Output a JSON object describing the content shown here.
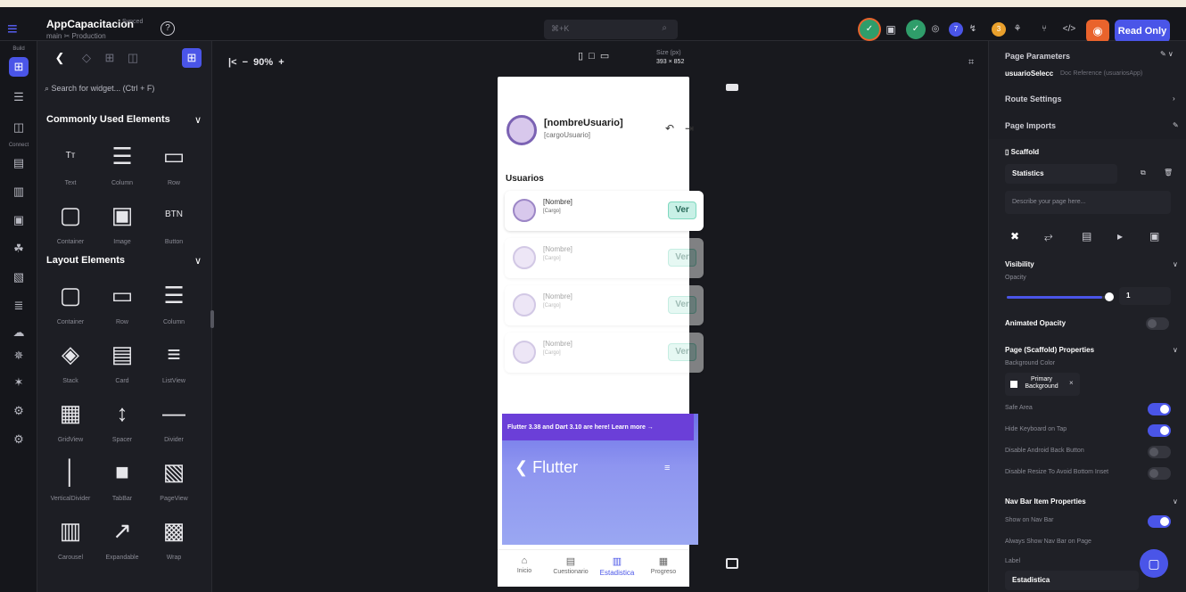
{
  "app": {
    "title": "AppCapacitacion",
    "synced": "Synced",
    "branch": "main ✂ Production"
  },
  "topbar": {
    "search_placeholder": "⌘+K",
    "read_only": "Read Only",
    "badge1": "7",
    "badge2": "3"
  },
  "rail": {
    "build_label": "Build",
    "connect_label": "Connect"
  },
  "widgets": {
    "search_placeholder": "Search for widget... (Ctrl + F)",
    "common_title": "Commonly Used Elements",
    "common": [
      {
        "label": "Text",
        "icon": "Tт"
      },
      {
        "label": "Column",
        "icon": "☰"
      },
      {
        "label": "Row",
        "icon": "▭"
      },
      {
        "label": "Container",
        "icon": "▢"
      },
      {
        "label": "Image",
        "icon": "▣"
      },
      {
        "label": "Button",
        "icon": "BTN"
      }
    ],
    "layout_title": "Layout Elements",
    "layout": [
      {
        "label": "Container",
        "icon": "▢"
      },
      {
        "label": "Row",
        "icon": "▭"
      },
      {
        "label": "Column",
        "icon": "☰"
      },
      {
        "label": "Stack",
        "icon": "◈"
      },
      {
        "label": "Card",
        "icon": "▤"
      },
      {
        "label": "ListView",
        "icon": "≡"
      },
      {
        "label": "GridView",
        "icon": "▦"
      },
      {
        "label": "Spacer",
        "icon": "↕"
      },
      {
        "label": "Divider",
        "icon": "—"
      },
      {
        "label": "VerticalDivider",
        "icon": "│"
      },
      {
        "label": "TabBar",
        "icon": "■"
      },
      {
        "label": "PageView",
        "icon": "▧"
      },
      {
        "label": "Carousel",
        "icon": "▥"
      },
      {
        "label": "Expandable",
        "icon": "↗"
      },
      {
        "label": "Wrap",
        "icon": "▩"
      }
    ]
  },
  "canvas": {
    "zoom": "90%",
    "size_label": "Size (px)",
    "size_value": "393 × 852"
  },
  "phone": {
    "user_name": "[nombreUsuario]",
    "user_cargo": "[cargoUsuario]",
    "section": "Usuarios",
    "cards": [
      {
        "name": "[Nombre]",
        "cargo": "[Cargo]",
        "button": "Ver"
      },
      {
        "name": "[Nombre]",
        "cargo": "[Cargo]",
        "button": "Ver"
      },
      {
        "name": "[Nombre]",
        "cargo": "[Cargo]",
        "button": "Ver"
      },
      {
        "name": "[Nombre]",
        "cargo": "[Cargo]",
        "button": "Ver"
      }
    ],
    "banner_text": "Flutter 3.38 and Dart 3.10 are here! Learn more →",
    "banner_logo": "Flutter",
    "nav": [
      {
        "label": "Inicio",
        "icon": "⌂"
      },
      {
        "label": "Cuestionario",
        "icon": "▤"
      },
      {
        "label": "Estadistica",
        "icon": "▥"
      },
      {
        "label": "Progreso",
        "icon": "▦"
      }
    ]
  },
  "props": {
    "page_params": "Page Parameters",
    "param_name": "usuarioSelecc",
    "param_type": "Doc Reference (usuariosApp)",
    "route": "Route Settings",
    "imports": "Page Imports",
    "scaffold": "Scaffold",
    "page_name": "Statistics",
    "describe_placeholder": "Describe your page here...",
    "visibility": "Visibility",
    "opacity": "Opacity",
    "opacity_value": "1",
    "opacity_level": 0.92,
    "animated_opacity": "Animated Opacity",
    "scaffold_props": "Page (Scaffold) Properties",
    "bg_color": "Background Color",
    "bg_value": "Primary Background",
    "safe_area": "Safe Area",
    "hide_kb": "Hide Keyboard on Tap",
    "disable_back": "Disable Android Back Button",
    "disable_resize": "Disable Resize To Avoid Bottom Inset",
    "nav_props": "Nav Bar Item Properties",
    "show_nav": "Show on Nav Bar",
    "always_nav": "Always Show Nav Bar on Page",
    "label": "Label",
    "label_value": "Estadistica"
  }
}
